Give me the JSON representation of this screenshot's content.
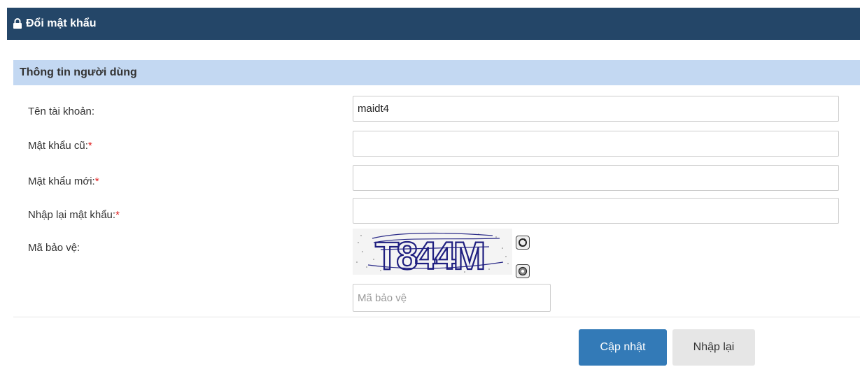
{
  "header": {
    "title": "Đổi mật khẩu",
    "icon": "lock-icon",
    "bg_color": "#244668"
  },
  "section": {
    "title": "Thông tin người dùng",
    "bg_color": "#c3d8f2"
  },
  "form": {
    "username_label": "Tên tài khoản:",
    "username_value": "maidt4",
    "old_password_label": "Mật khẩu cũ:",
    "new_password_label": "Mật khẩu mới:",
    "confirm_password_label": "Nhập lại mật khẩu:",
    "required_mark": "*",
    "captcha_label": "Mã bảo vệ:",
    "captcha_text": "T844M",
    "captcha_placeholder": "Mã bảo vệ"
  },
  "buttons": {
    "update": "Cập nhật",
    "reset": "Nhập lại"
  },
  "colors": {
    "primary": "#337ab7",
    "required": "#e02020"
  }
}
